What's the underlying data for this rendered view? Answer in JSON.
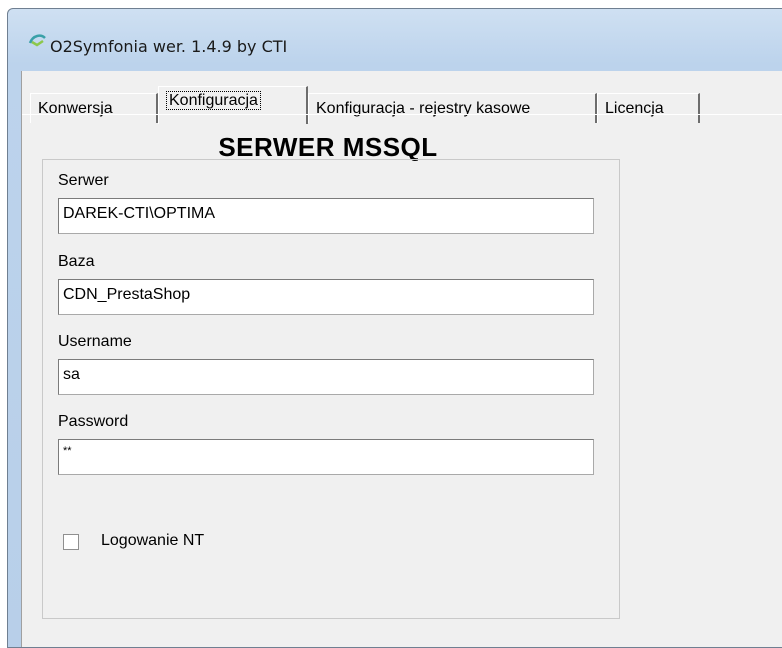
{
  "window": {
    "title": "O2Symfonia  wer. 1.4.9 by CTI",
    "icon": "app-icon"
  },
  "tabs": [
    {
      "label": "Konwersja",
      "active": false
    },
    {
      "label": "Konfiguracja",
      "active": true
    },
    {
      "label": "Konfiguracja - rejestry kasowe",
      "active": false
    },
    {
      "label": "Licencja",
      "active": false
    }
  ],
  "page": {
    "header": "SERWER MSSQL",
    "fields": {
      "serwer": {
        "label": "Serwer",
        "value": "DAREK-CTI\\OPTIMA"
      },
      "baza": {
        "label": "Baza",
        "value": "CDN_PrestaShop"
      },
      "username": {
        "label": "Username",
        "value": "sa"
      },
      "password": {
        "label": "Password",
        "value": "**"
      }
    },
    "checkbox": {
      "label": "Logowanie NT",
      "checked": false
    }
  }
}
